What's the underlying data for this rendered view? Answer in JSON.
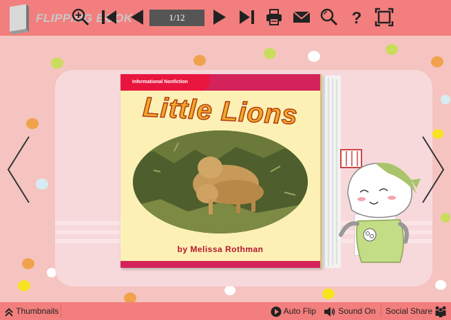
{
  "app": {
    "logo_text": "FLIPPING BOOK"
  },
  "toolbar": {
    "page_indicator": "1/12",
    "icons": [
      "zoom-in-icon",
      "first-page-icon",
      "previous-page-icon",
      "next-page-icon",
      "last-page-icon",
      "print-icon",
      "email-icon",
      "search-icon",
      "help-icon",
      "fullscreen-icon"
    ]
  },
  "book": {
    "tag": "Informational Nonfiction",
    "title": "Little Lions",
    "author": "by Melissa Rothman"
  },
  "bottom_bar": {
    "thumbnails_label": "Thumbnails",
    "auto_flip_label": "Auto Flip",
    "sound_label": "Sound On",
    "social_share_label": "Social Share"
  },
  "colors": {
    "toolbar": "#f27f7d",
    "background": "#f5c4c0",
    "panel": "#f7d9dc",
    "accent": "#d4235b"
  }
}
